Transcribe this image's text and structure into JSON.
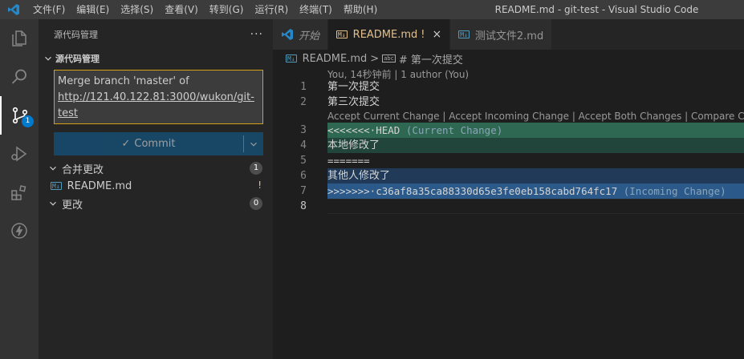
{
  "titlebar": {
    "menu": [
      "文件(F)",
      "编辑(E)",
      "选择(S)",
      "查看(V)",
      "转到(G)",
      "运行(R)",
      "终端(T)",
      "帮助(H)"
    ],
    "window_title": "README.md - git-test - Visual Studio Code"
  },
  "activitybar": {
    "items": [
      "explorer-icon",
      "search-icon",
      "source-control-icon",
      "run-debug-icon",
      "extensions-icon",
      "lightning-icon"
    ],
    "scm_badge": "1"
  },
  "sidebar": {
    "header_title": "源代码管理",
    "more": "···",
    "section_title": "源代码管理",
    "commit_message_line1": "Merge branch 'master' of",
    "commit_message_url1": "http://121.40.122.81:3000/wukon/git-",
    "commit_message_url2": "test",
    "commit_button": "Commit",
    "merge_group": {
      "label": "合并更改",
      "count": "1"
    },
    "merge_file": {
      "icon": "M↓",
      "name": "README.md",
      "status": "!"
    },
    "changes_group": {
      "label": "更改",
      "count": "0"
    }
  },
  "tabs": [
    {
      "label": "开始",
      "icon": "vscode-icon",
      "active": false
    },
    {
      "label": "README.md",
      "mark": "!",
      "icon": "M↓",
      "active": true,
      "close": "×"
    },
    {
      "label": "测试文件2.md",
      "icon": "M↓",
      "active": false
    }
  ],
  "breadcrumb": {
    "file": "README.md",
    "sep": ">",
    "symbol_icon": "abc",
    "symbol": "# 第一次提交"
  },
  "editor": {
    "codelens_blame": "You, 14秒钟前 | 1 author (You)",
    "codelens_merge": "Accept Current Change | Accept Incoming Change | Accept Both Changes | Compare Changes",
    "lines": [
      {
        "num": "1",
        "text": "第一次提交"
      },
      {
        "num": "2",
        "text": "第三次提交"
      },
      {
        "num": "3",
        "text": "<<<<<<<·HEAD",
        "suffix": " (Current Change)"
      },
      {
        "num": "4",
        "text": "本地修改了"
      },
      {
        "num": "5",
        "text": "======="
      },
      {
        "num": "6",
        "text": "其他人修改了"
      },
      {
        "num": "7",
        "text": ">>>>>>>·c36af8a35ca88330d65e3fe0eb158cabd764fc17",
        "suffix": " (Incoming Change)"
      },
      {
        "num": "8",
        "text": ""
      }
    ]
  },
  "colors": {
    "accent": "#007acc",
    "modified": "#e2c08d",
    "current_marker": "#2f6852",
    "incoming_marker": "#2b5a8a"
  }
}
